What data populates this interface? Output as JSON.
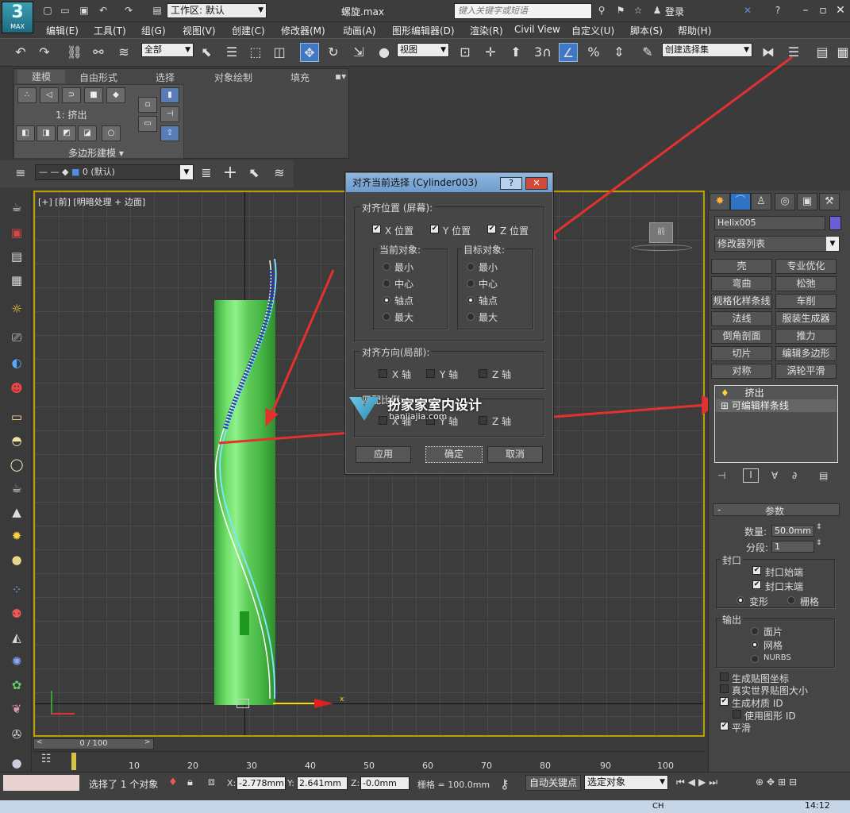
{
  "app": {
    "logo": "MAX",
    "workspace_label": "工作区: 默认",
    "filename": "螺旋.max",
    "search_placeholder": "键入关键字或短语",
    "login": "登录"
  },
  "menus": [
    "编辑(E)",
    "工具(T)",
    "组(G)",
    "视图(V)",
    "创建(C)",
    "修改器(M)",
    "动画(A)",
    "图形编辑器(D)",
    "渲染(R)",
    "Civil View",
    "自定义(U)",
    "脚本(S)",
    "帮助(H)"
  ],
  "toolbar": {
    "filter": "全部",
    "ref_coord": "视图",
    "snap_num": "3",
    "selection_set": "创建选择集"
  },
  "ribbon": {
    "tabs": [
      "建模",
      "自由形式",
      "选择",
      "对象绘制",
      "填充"
    ],
    "panel_label": "1: 挤出",
    "footer": "多边形建模"
  },
  "layer": {
    "name": "0 (默认)"
  },
  "viewport": {
    "label": "[+] [前] [明暗处理 + 边面]",
    "axis_x": "x"
  },
  "dialog": {
    "title": "对齐当前选择 (Cylinder003)",
    "help_btn": "?",
    "close_btn": "✕",
    "pos_group": "对齐位置 (屏幕):",
    "x_pos": "X 位置",
    "y_pos": "Y 位置",
    "z_pos": "Z 位置",
    "current_group": "当前对象:",
    "target_group": "目标对象:",
    "opt_min": "最小",
    "opt_center": "中心",
    "opt_pivot": "轴点",
    "opt_max": "最大",
    "orient_group": "对齐方向(局部):",
    "x_axis": "X 轴",
    "y_axis": "Y 轴",
    "z_axis": "Z 轴",
    "scale_group": "匹配比例:",
    "apply": "应用",
    "ok": "确定",
    "cancel": "取消"
  },
  "watermark": {
    "name": "扮家家室内设计",
    "url": "banjiajia.com"
  },
  "command_panel": {
    "object_name": "Helix005",
    "modifier_list": "修改器列表",
    "modifiers": [
      "壳",
      "专业优化",
      "弯曲",
      "松弛",
      "规格化样条线",
      "车削",
      "法线",
      "服装生成器",
      "倒角剖面",
      "推力",
      "切片",
      "编辑多边形",
      "对称",
      "涡轮平滑"
    ],
    "stack": [
      "挤出",
      "可编辑样条线"
    ],
    "params_title": "参数",
    "amount_label": "数量:",
    "amount_value": "50.0mm",
    "segments_label": "分段:",
    "segments_value": "1",
    "capping_title": "封口",
    "cap_start": "封口始端",
    "cap_end": "封口末端",
    "morph": "变形",
    "grid": "栅格",
    "output_title": "输出",
    "patch": "面片",
    "mesh": "网格",
    "nurbs": "NURBS",
    "gen_map": "生成贴图坐标",
    "real_world": "真实世界贴图大小",
    "gen_mat": "生成材质 ID",
    "use_shape": "使用图形 ID",
    "smooth": "平滑"
  },
  "timeline": {
    "frame": "0 / 100",
    "ticks": [
      "10",
      "20",
      "30",
      "40",
      "50",
      "60",
      "70",
      "80",
      "90",
      "100"
    ]
  },
  "status": {
    "selected": "选择了 1 个对象",
    "x_label": "X:",
    "x_value": "-2.778mm",
    "y_label": "Y:",
    "y_value": "2.641mm",
    "z_label": "Z:",
    "z_value": "-0.0mm",
    "grid": "栅格 = 100.0mm",
    "autokey": "自动关键点",
    "set_key": "选定对象",
    "ime": "CH",
    "clock": "14:12"
  }
}
